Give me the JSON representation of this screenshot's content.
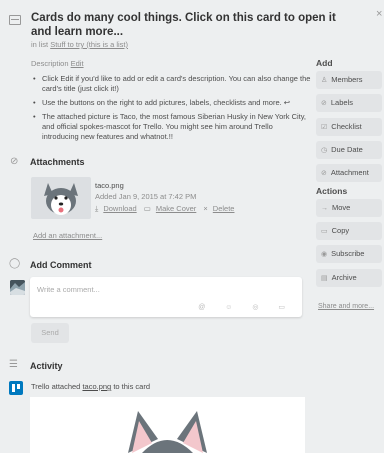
{
  "card": {
    "title": "Cards do many cool things. Click on this card to open it and learn more...",
    "in_list_prefix": "in list",
    "list_name": "Stuff to try (this is a list)",
    "close_glyph": "×"
  },
  "description": {
    "label": "Description",
    "edit_label": "Edit",
    "items": [
      "Click Edit if you'd like to add or edit a card's description. You can also change the card's title (just click it!)",
      "Use the buttons on the right to add pictures, labels, checklists and more. ↩",
      "The attached picture is Taco, the most famous Siberian Husky in New York City, and official spokes-mascot for Trello. You might see him around Trello introducing new features and whatnot.!!"
    ]
  },
  "attachments": {
    "title": "Attachments",
    "file_name": "taco.png",
    "added": "Added Jan 9, 2015 at 7:42 PM",
    "download": "Download",
    "make_cover": "Make Cover",
    "delete": "Delete",
    "add_link": "Add an attachment..."
  },
  "comment": {
    "title": "Add Comment",
    "placeholder": "Write a comment...",
    "tools": "@ ☺ ◎ ▭",
    "send": "Send"
  },
  "activity": {
    "title": "Activity",
    "actor": "Trello",
    "verb": "attached",
    "object": "taco.png",
    "suffix": "to this card"
  },
  "sidebar": {
    "add_title": "Add",
    "add_buttons": [
      {
        "icon": "♙",
        "label": "Members"
      },
      {
        "icon": "⊘",
        "label": "Labels"
      },
      {
        "icon": "☑",
        "label": "Checklist"
      },
      {
        "icon": "◷",
        "label": "Due Date"
      },
      {
        "icon": "⊘",
        "label": "Attachment"
      }
    ],
    "actions_title": "Actions",
    "action_buttons": [
      {
        "icon": "→",
        "label": "Move"
      },
      {
        "icon": "▭",
        "label": "Copy"
      },
      {
        "icon": "◉",
        "label": "Subscribe"
      },
      {
        "icon": "▤",
        "label": "Archive"
      }
    ],
    "share": "Share and more..."
  },
  "colors": {
    "background": "#edeff0",
    "button": "#e2e4e6",
    "trello_blue": "#0079bf"
  }
}
